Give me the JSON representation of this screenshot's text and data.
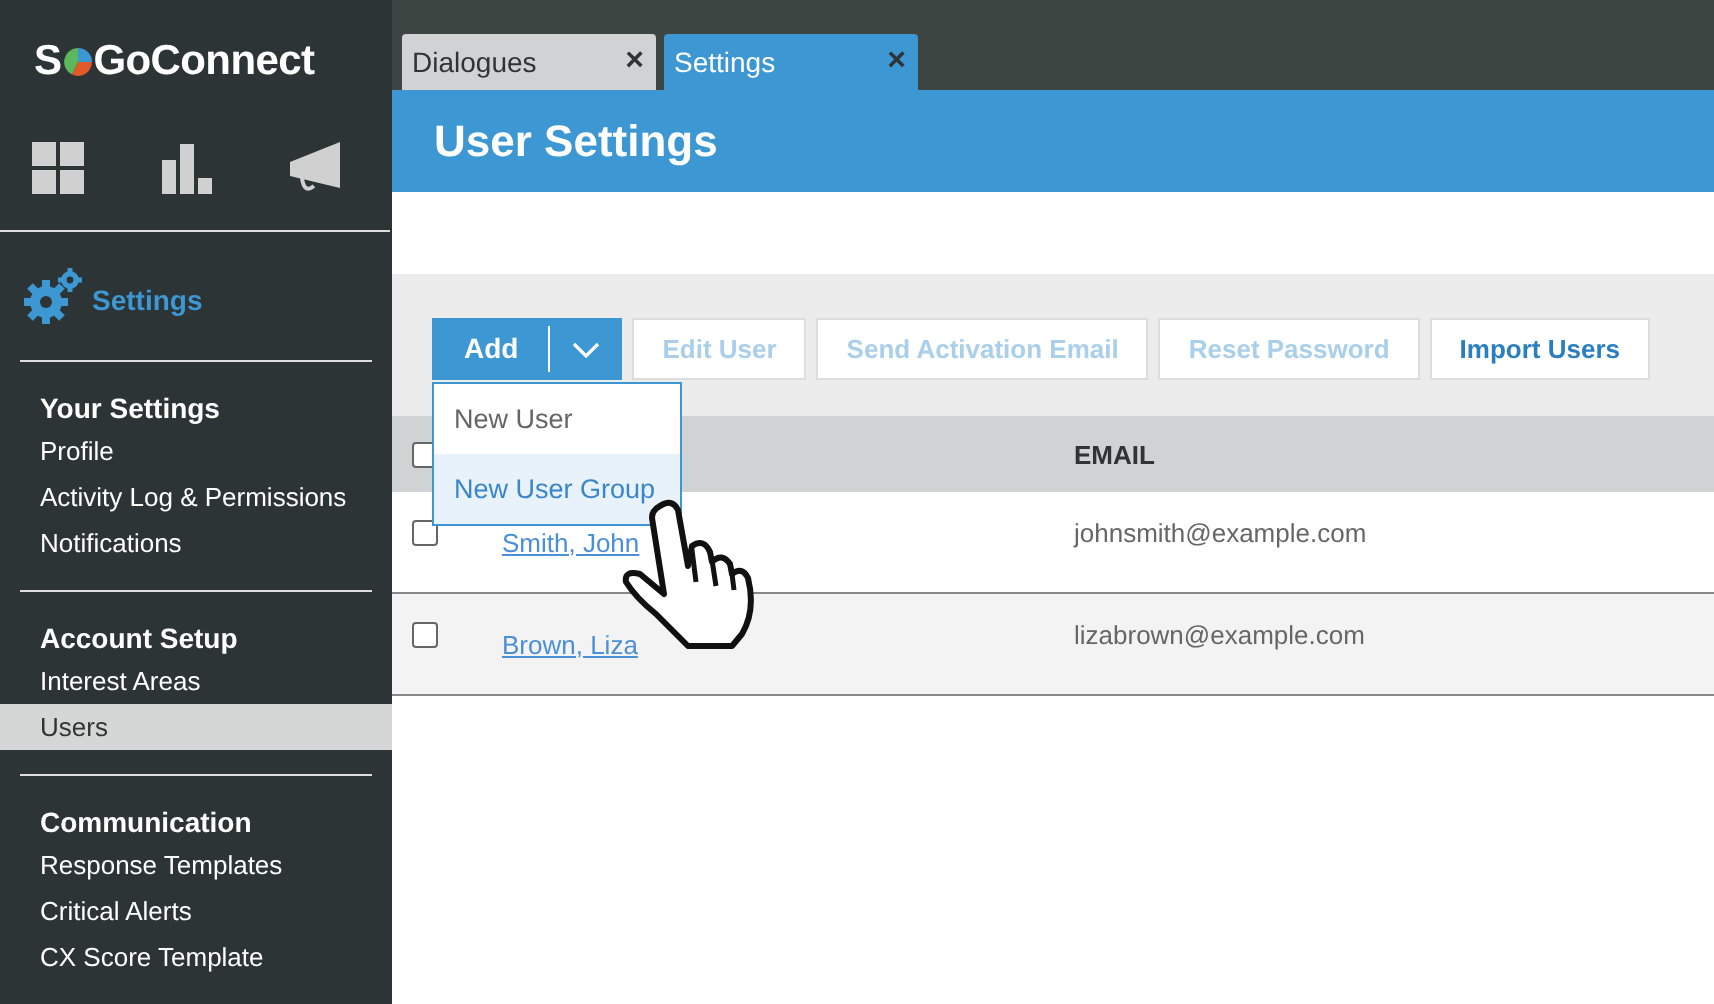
{
  "logo": {
    "left": "S",
    "right": "GoConnect"
  },
  "sidebar": {
    "current": "Settings",
    "sections": [
      {
        "heading": "Your Settings",
        "items": [
          {
            "label": "Profile",
            "selected": false
          },
          {
            "label": "Activity Log & Permissions",
            "selected": false
          },
          {
            "label": "Notifications",
            "selected": false
          }
        ]
      },
      {
        "heading": "Account Setup",
        "items": [
          {
            "label": "Interest Areas",
            "selected": false
          },
          {
            "label": "Users",
            "selected": true
          }
        ]
      },
      {
        "heading": "Communication",
        "items": [
          {
            "label": "Response Templates",
            "selected": false
          },
          {
            "label": "Critical Alerts",
            "selected": false
          },
          {
            "label": "CX Score Template",
            "selected": false
          }
        ]
      }
    ]
  },
  "tabs": [
    {
      "label": "Dialogues",
      "close": "×",
      "selected": false
    },
    {
      "label": "Settings",
      "close": "×",
      "selected": true
    }
  ],
  "page_title": "User Settings",
  "toolbar": {
    "add": "Add",
    "buttons": [
      {
        "label": "Edit User",
        "disabled": true
      },
      {
        "label": "Send Activation Email",
        "disabled": true
      },
      {
        "label": "Reset Password",
        "disabled": true
      },
      {
        "label": "Import Users",
        "disabled": false
      }
    ]
  },
  "menu": [
    {
      "label": "New User",
      "selected": false
    },
    {
      "label": "New User Group",
      "selected": true
    }
  ],
  "table": {
    "header_checked": false,
    "columns": [
      "EMAIL"
    ],
    "rows": [
      {
        "name": "Smith, John",
        "email": "johnsmith@example.com",
        "checked": false
      },
      {
        "name": "Brown, Liza",
        "email": "lizabrown@example.com",
        "checked": false
      }
    ]
  }
}
